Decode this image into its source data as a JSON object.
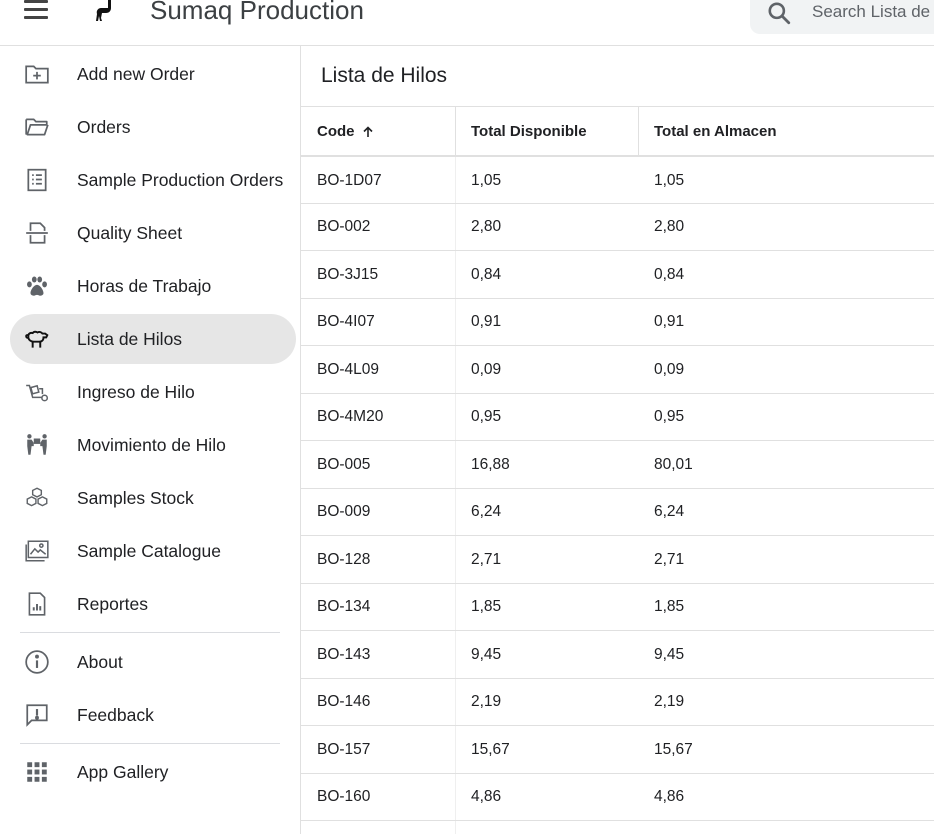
{
  "app": {
    "title": "Sumaq Production"
  },
  "search": {
    "placeholder": "Search Lista de Hilos"
  },
  "sidebar": {
    "items": [
      {
        "label": "Add new Order",
        "icon": "add-folder-icon"
      },
      {
        "label": "Orders",
        "icon": "folder-open-icon"
      },
      {
        "label": "Sample Production Orders",
        "icon": "list-document-icon"
      },
      {
        "label": "Quality Sheet",
        "icon": "document-scan-icon"
      },
      {
        "label": "Horas de Trabajo",
        "icon": "paw-icon"
      },
      {
        "label": "Lista de Hilos",
        "icon": "sheep-icon",
        "active": true
      },
      {
        "label": "Ingreso de Hilo",
        "icon": "cart-icon"
      },
      {
        "label": "Movimiento de Hilo",
        "icon": "people-carry-icon"
      },
      {
        "label": "Samples Stock",
        "icon": "boxes-icon"
      },
      {
        "label": "Sample Catalogue",
        "icon": "image-gallery-icon"
      },
      {
        "label": "Reportes",
        "icon": "report-icon"
      }
    ],
    "secondary": [
      {
        "label": "About",
        "icon": "info-icon"
      },
      {
        "label": "Feedback",
        "icon": "feedback-icon"
      }
    ],
    "gallery": {
      "label": "App Gallery",
      "icon": "apps-grid-icon"
    }
  },
  "main": {
    "title": "Lista de Hilos",
    "columns": [
      "Code",
      "Total Disponible",
      "Total en Almacen"
    ],
    "rows": [
      [
        "BO-1D07",
        "1,05",
        "1,05"
      ],
      [
        "BO-002",
        "2,80",
        "2,80"
      ],
      [
        "BO-3J15",
        "0,84",
        "0,84"
      ],
      [
        "BO-4I07",
        "0,91",
        "0,91"
      ],
      [
        "BO-4L09",
        "0,09",
        "0,09"
      ],
      [
        "BO-4M20",
        "0,95",
        "0,95"
      ],
      [
        "BO-005",
        "16,88",
        "80,01"
      ],
      [
        "BO-009",
        "6,24",
        "6,24"
      ],
      [
        "BO-128",
        "2,71",
        "2,71"
      ],
      [
        "BO-134",
        "1,85",
        "1,85"
      ],
      [
        "BO-143",
        "9,45",
        "9,45"
      ],
      [
        "BO-146",
        "2,19",
        "2,19"
      ],
      [
        "BO-157",
        "15,67",
        "15,67"
      ],
      [
        "BO-160",
        "4,86",
        "4,86"
      ]
    ]
  },
  "colors": {
    "active_bg": "#e6e6e6",
    "divider": "#e0e0e0",
    "text": "#202124"
  }
}
